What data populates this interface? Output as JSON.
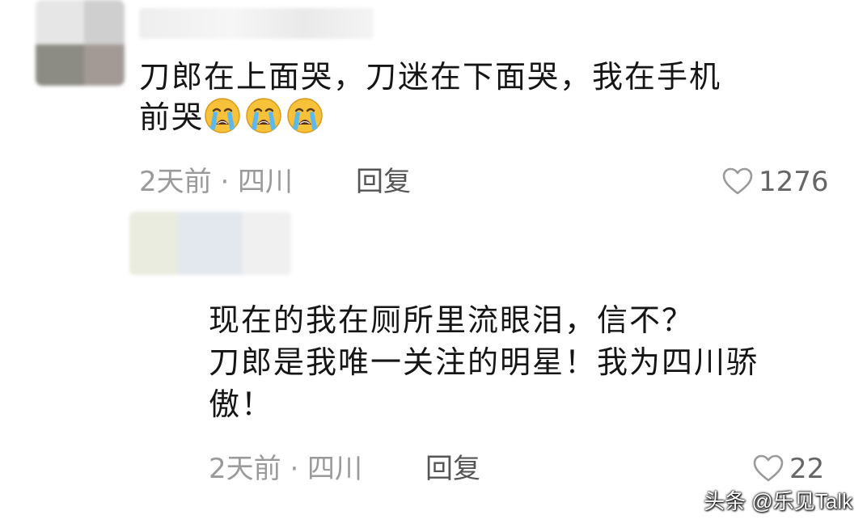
{
  "comments": [
    {
      "text_line1": "刀郎在上面哭，刀迷在下面哭，我在手机",
      "text_line2": "前哭",
      "emoji_count": 3,
      "time_location": "2天前 · 四川",
      "reply_label": "回复",
      "likes": "1276"
    },
    {
      "text_line1": "现在的我在厕所里流眼泪，信不？",
      "text_line2": "刀郎是我唯一关注的明星！我为四川骄",
      "text_line3": "傲！",
      "time_location": "2天前 · 四川",
      "reply_label": "回复",
      "likes": "22"
    }
  ],
  "watermark": "头条 @乐见Talk",
  "icons": {
    "like": "heart-outline-icon",
    "emoji": "loudly-crying-face-emoji"
  },
  "colors": {
    "text": "#151515",
    "meta": "#9a9a9a",
    "emoji_face": "#f7c23a",
    "tears": "#5cb8f0"
  }
}
